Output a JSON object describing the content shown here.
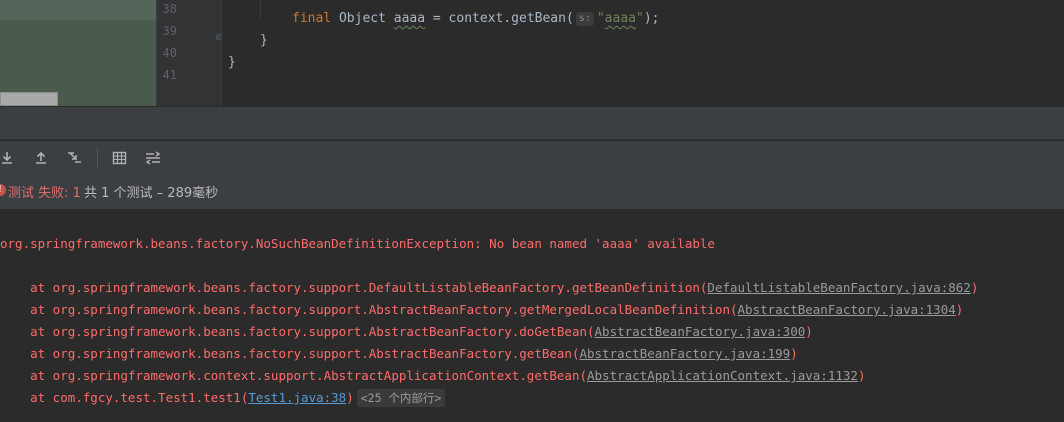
{
  "editor": {
    "lines": [
      {
        "num": "38"
      },
      {
        "num": "39"
      },
      {
        "num": "40"
      },
      {
        "num": "41"
      }
    ],
    "code": {
      "line38": {
        "kw_final": "final",
        "type": " Object ",
        "var": "aaaa",
        "rest": " = context.getBean(",
        "hint": "s:",
        "str_open": "\"",
        "str_val": "aaaa",
        "str_close": "\"",
        "end": ");"
      },
      "line39": "}",
      "line40": "}"
    }
  },
  "status": {
    "fail_text": "测试 失败: 1",
    "summary": "共 1 个测试 – 289毫秒"
  },
  "console": {
    "exception": "org.springframework.beans.factory.NoSuchBeanDefinitionException: No bean named 'aaaa' available",
    "frames": [
      {
        "prefix": "    at org.springframework.beans.factory.support.DefaultListableBeanFactory.getBeanDefinition(",
        "link": "DefaultListableBeanFactory.java:862",
        "suffix": ")"
      },
      {
        "prefix": "    at org.springframework.beans.factory.support.AbstractBeanFactory.getMergedLocalBeanDefinition(",
        "link": "AbstractBeanFactory.java:1304",
        "suffix": ")"
      },
      {
        "prefix": "    at org.springframework.beans.factory.support.AbstractBeanFactory.doGetBean(",
        "link": "AbstractBeanFactory.java:300",
        "suffix": ")"
      },
      {
        "prefix": "    at org.springframework.beans.factory.support.AbstractBeanFactory.getBean(",
        "link": "AbstractBeanFactory.java:199",
        "suffix": ")"
      },
      {
        "prefix": "    at org.springframework.context.support.AbstractApplicationContext.getBean(",
        "link": "AbstractApplicationContext.java:1132",
        "suffix": ")"
      },
      {
        "prefix": "    at com.fgcy.test.Test1.test1(",
        "link": "Test1.java:38",
        "suffix": ")",
        "badge": "<25 个内部行>"
      }
    ]
  },
  "toolbar": {
    "icons": [
      "import-icon",
      "export-icon",
      "scroll-to-end-icon",
      "table-icon",
      "compare-icon"
    ]
  },
  "colors": {
    "error": "#ff6b68",
    "keyword": "#cc7832",
    "string": "#6a8759",
    "link_blue": "#5a9bd5"
  }
}
